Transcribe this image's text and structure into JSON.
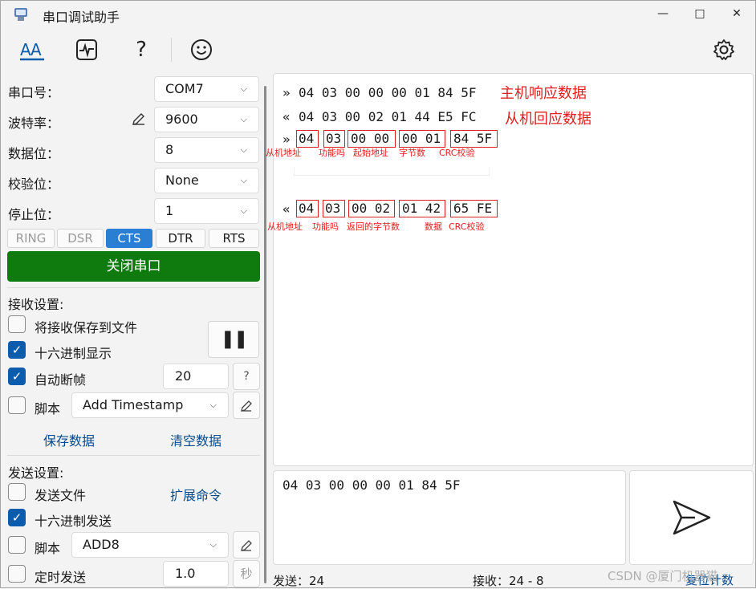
{
  "window": {
    "title": "串口调试助手",
    "minimize": "—",
    "maximize": "□",
    "close": "✕"
  },
  "toolbar": {
    "icons": [
      "text-style-icon",
      "waveform-icon",
      "help-icon",
      "smiley-icon",
      "gear-icon"
    ],
    "help_glyph": "?"
  },
  "serial": {
    "port_label": "串口号：",
    "port_value": "COM7",
    "baud_label": "波特率：",
    "baud_value": "9600",
    "databits_label": "数据位：",
    "databits_value": "8",
    "parity_label": "校验位：",
    "parity_value": "None",
    "stopbits_label": "停止位：",
    "stopbits_value": "1",
    "signals": [
      {
        "label": "RING",
        "active": false,
        "enabled": false
      },
      {
        "label": "DSR",
        "active": false,
        "enabled": false
      },
      {
        "label": "CTS",
        "active": true,
        "enabled": true
      },
      {
        "label": "DTR",
        "active": false,
        "enabled": true
      },
      {
        "label": "RTS",
        "active": false,
        "enabled": true
      }
    ],
    "close_button": "关闭串口"
  },
  "receive": {
    "section_title": "接收设置:",
    "save_to_file": "将接收保存到文件",
    "save_to_file_checked": false,
    "hex_display": "十六进制显示",
    "hex_display_checked": true,
    "auto_frame": "自动断帧",
    "auto_frame_checked": true,
    "auto_frame_value": "20",
    "auto_frame_help": "?",
    "script": "脚本",
    "script_checked": false,
    "script_value": "Add Timestamp",
    "save_data": "保存数据",
    "clear_data": "清空数据",
    "pause_glyph": "❚❚"
  },
  "send": {
    "section_title": "发送设置:",
    "send_file": "发送文件",
    "send_file_checked": false,
    "hex_send": "十六进制发送",
    "hex_send_checked": true,
    "ext_cmd": "扩展命令",
    "script": "脚本",
    "script_checked": false,
    "script_value": "ADD8",
    "timed_send": "定时发送",
    "timed_send_checked": false,
    "timed_value": "1.0",
    "timed_unit": "秒",
    "input_text": "04 03 00 00 00 01 84 5F"
  },
  "log": {
    "line1_arrow": "»",
    "line1_hex": "04 03 00 00 00 01 84 5F",
    "line1_note": "主机响应数据",
    "line2_arrow": "«",
    "line2_hex": "04 03 00 02 01 44 E5 FC",
    "line2_note": "从机回应数据",
    "line3_arrow": "»",
    "line3_groups": [
      "04",
      "03",
      "00 00",
      "00 01",
      "84 5F"
    ],
    "line3_labels": [
      "从机地址",
      "功能吗",
      "起始地址",
      "字节数",
      "CRC校验"
    ],
    "line4_arrow": "«",
    "line4_groups": [
      "04",
      "03",
      "00 02",
      "01 42",
      "65 FE"
    ],
    "line4_labels": [
      "从机地址",
      "功能吗",
      "返回的字节数",
      "数据",
      "CRC校验"
    ]
  },
  "status": {
    "sent": "发送：24",
    "recv": "接收：24 - 8",
    "reset": "复位计数",
    "watermark": "CSDN @厦门机器猫"
  }
}
